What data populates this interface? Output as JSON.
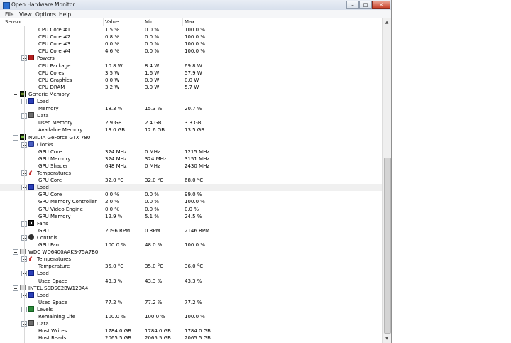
{
  "window": {
    "title": "Open Hardware Monitor",
    "buttons": {
      "minimize": "–",
      "maximize": "□",
      "close": "✕"
    }
  },
  "menu": [
    "File",
    "View",
    "Options",
    "Help"
  ],
  "columns": {
    "sensor": "Sensor",
    "value": "Value",
    "min": "Min",
    "max": "Max"
  },
  "colors": {
    "selected_row": "#f0f0f0",
    "power_icon": "#b41e1e",
    "load_icon": "#2b3fb8",
    "levels_icon": "#2c8a3a"
  },
  "rows": [
    {
      "label": "CPU Core #1",
      "value": "1.5 %",
      "min": "0.0 %",
      "max": "100.0 %",
      "indent": 3
    },
    {
      "label": "CPU Core #2",
      "value": "0.8 %",
      "min": "0.0 %",
      "max": "100.0 %",
      "indent": 3
    },
    {
      "label": "CPU Core #3",
      "value": "0.0 %",
      "min": "0.0 %",
      "max": "100.0 %",
      "indent": 3
    },
    {
      "label": "CPU Core #4",
      "value": "4.6 %",
      "min": "0.0 %",
      "max": "100.0 %",
      "indent": 3
    },
    {
      "label": "Powers",
      "value": "",
      "min": "",
      "max": "",
      "indent": 2,
      "expander": true,
      "icon": "power-icon",
      "iconClass": "ic-cpu-power"
    },
    {
      "label": "CPU Package",
      "value": "10.8 W",
      "min": "8.4 W",
      "max": "69.8 W",
      "indent": 3
    },
    {
      "label": "CPU Cores",
      "value": "3.5 W",
      "min": "1.6 W",
      "max": "57.9 W",
      "indent": 3
    },
    {
      "label": "CPU Graphics",
      "value": "0.0 W",
      "min": "0.0 W",
      "max": "0.0 W",
      "indent": 3
    },
    {
      "label": "CPU DRAM",
      "value": "3.2 W",
      "min": "3.0 W",
      "max": "5.7 W",
      "indent": 3
    },
    {
      "label": "Generic Memory",
      "value": "",
      "min": "",
      "max": "",
      "indent": 1,
      "expander": true,
      "icon": "memory-icon",
      "iconClass": "ic-memory"
    },
    {
      "label": "Load",
      "value": "",
      "min": "",
      "max": "",
      "indent": 2,
      "expander": true,
      "icon": "load-icon",
      "iconClass": "ic-load"
    },
    {
      "label": "Memory",
      "value": "18.3 %",
      "min": "15.3 %",
      "max": "20.7 %",
      "indent": 3
    },
    {
      "label": "Data",
      "value": "",
      "min": "",
      "max": "",
      "indent": 2,
      "expander": true,
      "icon": "data-icon",
      "iconClass": "ic-data"
    },
    {
      "label": "Used Memory",
      "value": "2.9 GB",
      "min": "2.4 GB",
      "max": "3.3 GB",
      "indent": 3
    },
    {
      "label": "Available Memory",
      "value": "13.0 GB",
      "min": "12.6 GB",
      "max": "13.5 GB",
      "indent": 3
    },
    {
      "label": "NVIDIA GeForce GTX 780",
      "value": "",
      "min": "",
      "max": "",
      "indent": 1,
      "expander": true,
      "icon": "gpu-icon",
      "iconClass": "ic-gpu"
    },
    {
      "label": "Clocks",
      "value": "",
      "min": "",
      "max": "",
      "indent": 2,
      "expander": true,
      "icon": "clock-icon",
      "iconClass": "ic-clock"
    },
    {
      "label": "GPU Core",
      "value": "324 MHz",
      "min": "0 MHz",
      "max": "1215 MHz",
      "indent": 3
    },
    {
      "label": "GPU Memory",
      "value": "324 MHz",
      "min": "324 MHz",
      "max": "3151 MHz",
      "indent": 3
    },
    {
      "label": "GPU Shader",
      "value": "648 MHz",
      "min": "0 MHz",
      "max": "2430 MHz",
      "indent": 3
    },
    {
      "label": "Temperatures",
      "value": "",
      "min": "",
      "max": "",
      "indent": 2,
      "expander": true,
      "icon": "thermometer-icon",
      "iconClass": "ic-temp"
    },
    {
      "label": "GPU Core",
      "value": "32.0 °C",
      "min": "32.0 °C",
      "max": "68.0 °C",
      "indent": 3
    },
    {
      "label": "Load",
      "value": "",
      "min": "",
      "max": "",
      "indent": 2,
      "expander": true,
      "icon": "load-icon",
      "iconClass": "ic-load",
      "selected": true
    },
    {
      "label": "GPU Core",
      "value": "0.0 %",
      "min": "0.0 %",
      "max": "99.0 %",
      "indent": 3
    },
    {
      "label": "GPU Memory Controller",
      "value": "2.0 %",
      "min": "0.0 %",
      "max": "100.0 %",
      "indent": 3
    },
    {
      "label": "GPU Video Engine",
      "value": "0.0 %",
      "min": "0.0 %",
      "max": "0.0 %",
      "indent": 3
    },
    {
      "label": "GPU Memory",
      "value": "12.9 %",
      "min": "5.1 %",
      "max": "24.5 %",
      "indent": 3
    },
    {
      "label": "Fans",
      "value": "",
      "min": "",
      "max": "",
      "indent": 2,
      "expander": true,
      "icon": "fan-icon",
      "iconClass": "ic-fan"
    },
    {
      "label": "GPU",
      "value": "2096 RPM",
      "min": "0 RPM",
      "max": "2146 RPM",
      "indent": 3
    },
    {
      "label": "Controls",
      "value": "",
      "min": "",
      "max": "",
      "indent": 2,
      "expander": true,
      "icon": "control-icon",
      "iconClass": "ic-control"
    },
    {
      "label": "GPU Fan",
      "value": "100.0 %",
      "min": "48.0 %",
      "max": "100.0 %",
      "indent": 3
    },
    {
      "label": "WDC WD6400AAKS-75A7B0",
      "value": "",
      "min": "",
      "max": "",
      "indent": 1,
      "expander": true,
      "icon": "hdd-icon",
      "iconClass": "ic-hdd"
    },
    {
      "label": "Temperatures",
      "value": "",
      "min": "",
      "max": "",
      "indent": 2,
      "expander": true,
      "icon": "thermometer-icon",
      "iconClass": "ic-temp"
    },
    {
      "label": "Temperature",
      "value": "35.0 °C",
      "min": "35.0 °C",
      "max": "36.0 °C",
      "indent": 3
    },
    {
      "label": "Load",
      "value": "",
      "min": "",
      "max": "",
      "indent": 2,
      "expander": true,
      "icon": "load-icon",
      "iconClass": "ic-load"
    },
    {
      "label": "Used Space",
      "value": "43.3 %",
      "min": "43.3 %",
      "max": "43.3 %",
      "indent": 3
    },
    {
      "label": "INTEL SSDSC2BW120A4",
      "value": "",
      "min": "",
      "max": "",
      "indent": 1,
      "expander": true,
      "icon": "hdd-icon",
      "iconClass": "ic-hdd"
    },
    {
      "label": "Load",
      "value": "",
      "min": "",
      "max": "",
      "indent": 2,
      "expander": true,
      "icon": "load-icon",
      "iconClass": "ic-load"
    },
    {
      "label": "Used Space",
      "value": "77.2 %",
      "min": "77.2 %",
      "max": "77.2 %",
      "indent": 3
    },
    {
      "label": "Levels",
      "value": "",
      "min": "",
      "max": "",
      "indent": 2,
      "expander": true,
      "icon": "levels-icon",
      "iconClass": "ic-levels"
    },
    {
      "label": "Remaining Life",
      "value": "100.0 %",
      "min": "100.0 %",
      "max": "100.0 %",
      "indent": 3
    },
    {
      "label": "Data",
      "value": "",
      "min": "",
      "max": "",
      "indent": 2,
      "expander": true,
      "icon": "data-icon",
      "iconClass": "ic-data"
    },
    {
      "label": "Host Writes",
      "value": "1784.0 GB",
      "min": "1784.0 GB",
      "max": "1784.0 GB",
      "indent": 3
    },
    {
      "label": "Host Reads",
      "value": "2065.5 GB",
      "min": "2065.5 GB",
      "max": "2065.5 GB",
      "indent": 3
    }
  ]
}
